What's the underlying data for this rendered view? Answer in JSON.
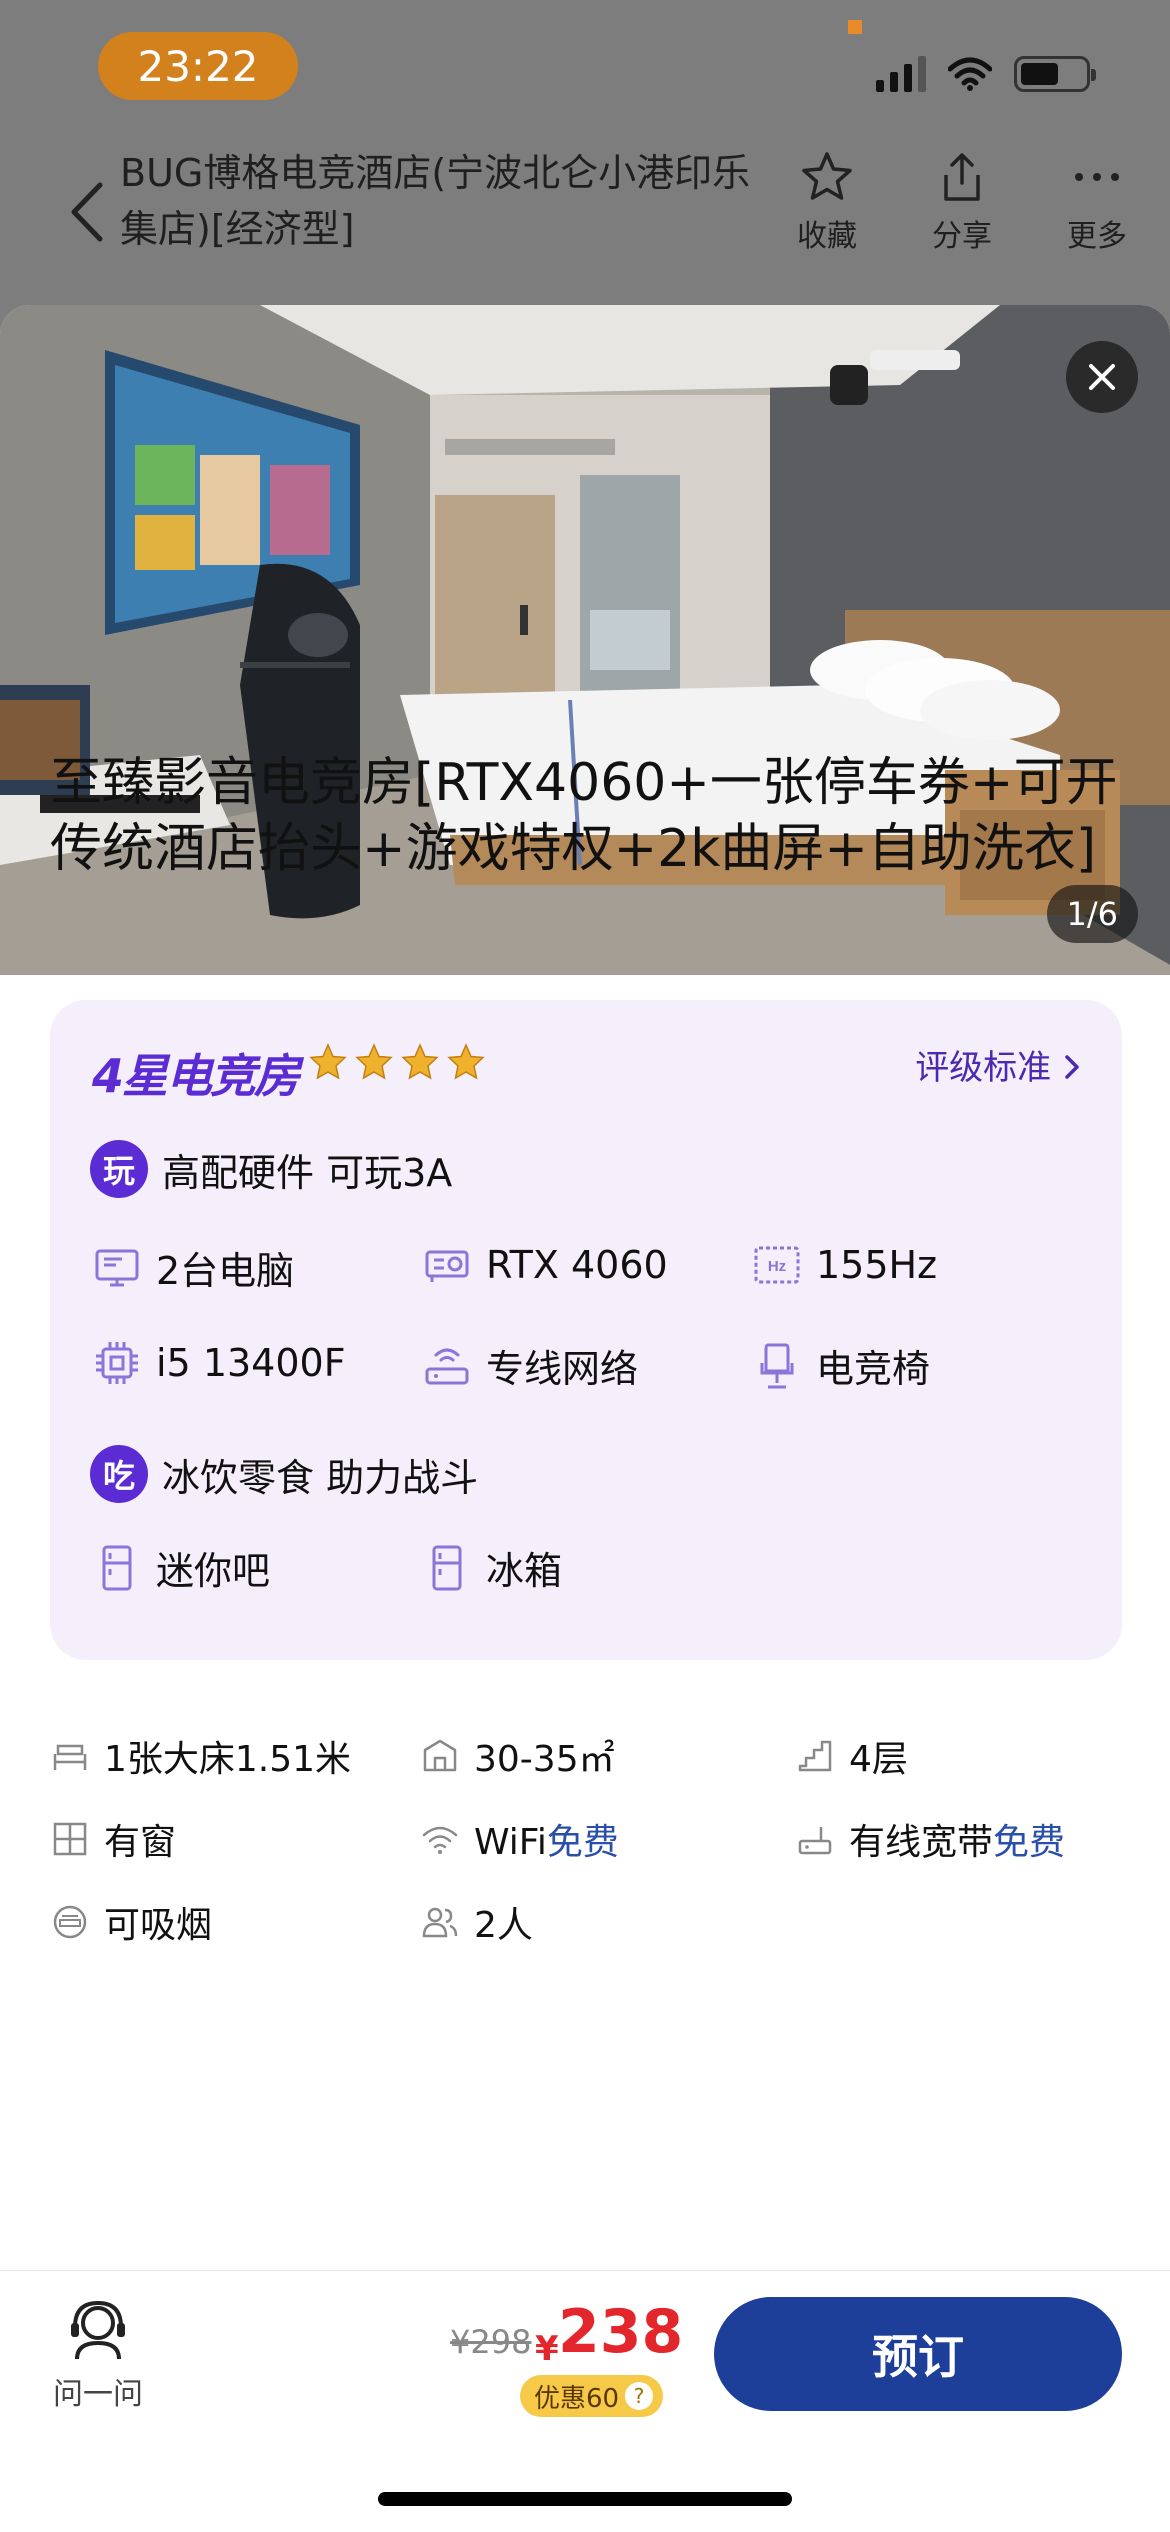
{
  "status": {
    "time": "23:22"
  },
  "header": {
    "hotel_title": "BUG博格电竞酒店(宁波北仑小港印乐集店)[经济型]",
    "actions": [
      {
        "label": "收藏",
        "icon": "star-icon"
      },
      {
        "label": "分享",
        "icon": "share-icon"
      },
      {
        "label": "更多",
        "icon": "more-icon"
      }
    ]
  },
  "gallery": {
    "counter": "1/6"
  },
  "room": {
    "title": "至臻影音电竞房[RTX4060+一张停车券+可开传统酒店抬头+游戏特权+2k曲屏+自助洗衣]"
  },
  "esports_card": {
    "grade": "4星电竞房",
    "star_count": 4,
    "standard_link": "评级标准",
    "play_section": {
      "badge": "玩",
      "title": "高配硬件 可玩3A",
      "features": [
        {
          "label": "2台电脑",
          "icon": "monitor-icon"
        },
        {
          "label": "RTX 4060",
          "icon": "gpu-icon"
        },
        {
          "label": "155Hz",
          "icon": "refresh-rate-icon"
        },
        {
          "label": "i5 13400F",
          "icon": "cpu-icon"
        },
        {
          "label": "专线网络",
          "icon": "router-icon"
        },
        {
          "label": "电竞椅",
          "icon": "gaming-chair-icon"
        }
      ]
    },
    "food_section": {
      "badge": "吃",
      "title": "冰饮零食 助力战斗",
      "features": [
        {
          "label": "迷你吧",
          "icon": "minibar-icon"
        },
        {
          "label": "冰箱",
          "icon": "fridge-icon"
        }
      ]
    }
  },
  "specs": [
    {
      "label": "1张大床1.51米",
      "icon": "bed-icon"
    },
    {
      "label": "30-35㎡",
      "icon": "area-icon"
    },
    {
      "label": "4层",
      "icon": "floor-icon"
    },
    {
      "label": "有窗",
      "icon": "window-icon"
    },
    {
      "label": "WiFi",
      "free": "免费",
      "icon": "wifi-icon"
    },
    {
      "label": "有线宽带",
      "free": "免费",
      "icon": "ethernet-icon"
    },
    {
      "label": "可吸烟",
      "icon": "smoking-icon"
    },
    {
      "label": "2人",
      "icon": "guests-icon"
    }
  ],
  "bottom": {
    "ask_label": "问一问",
    "original_price": "¥298",
    "currency": "¥",
    "price": "238",
    "discount": "优惠60",
    "book_label": "预订"
  },
  "colors": {
    "accent_purple": "#5b2bd4",
    "book_button": "#1e3f99",
    "price_red": "#e3262c",
    "discount_yellow": "#f7c948"
  }
}
